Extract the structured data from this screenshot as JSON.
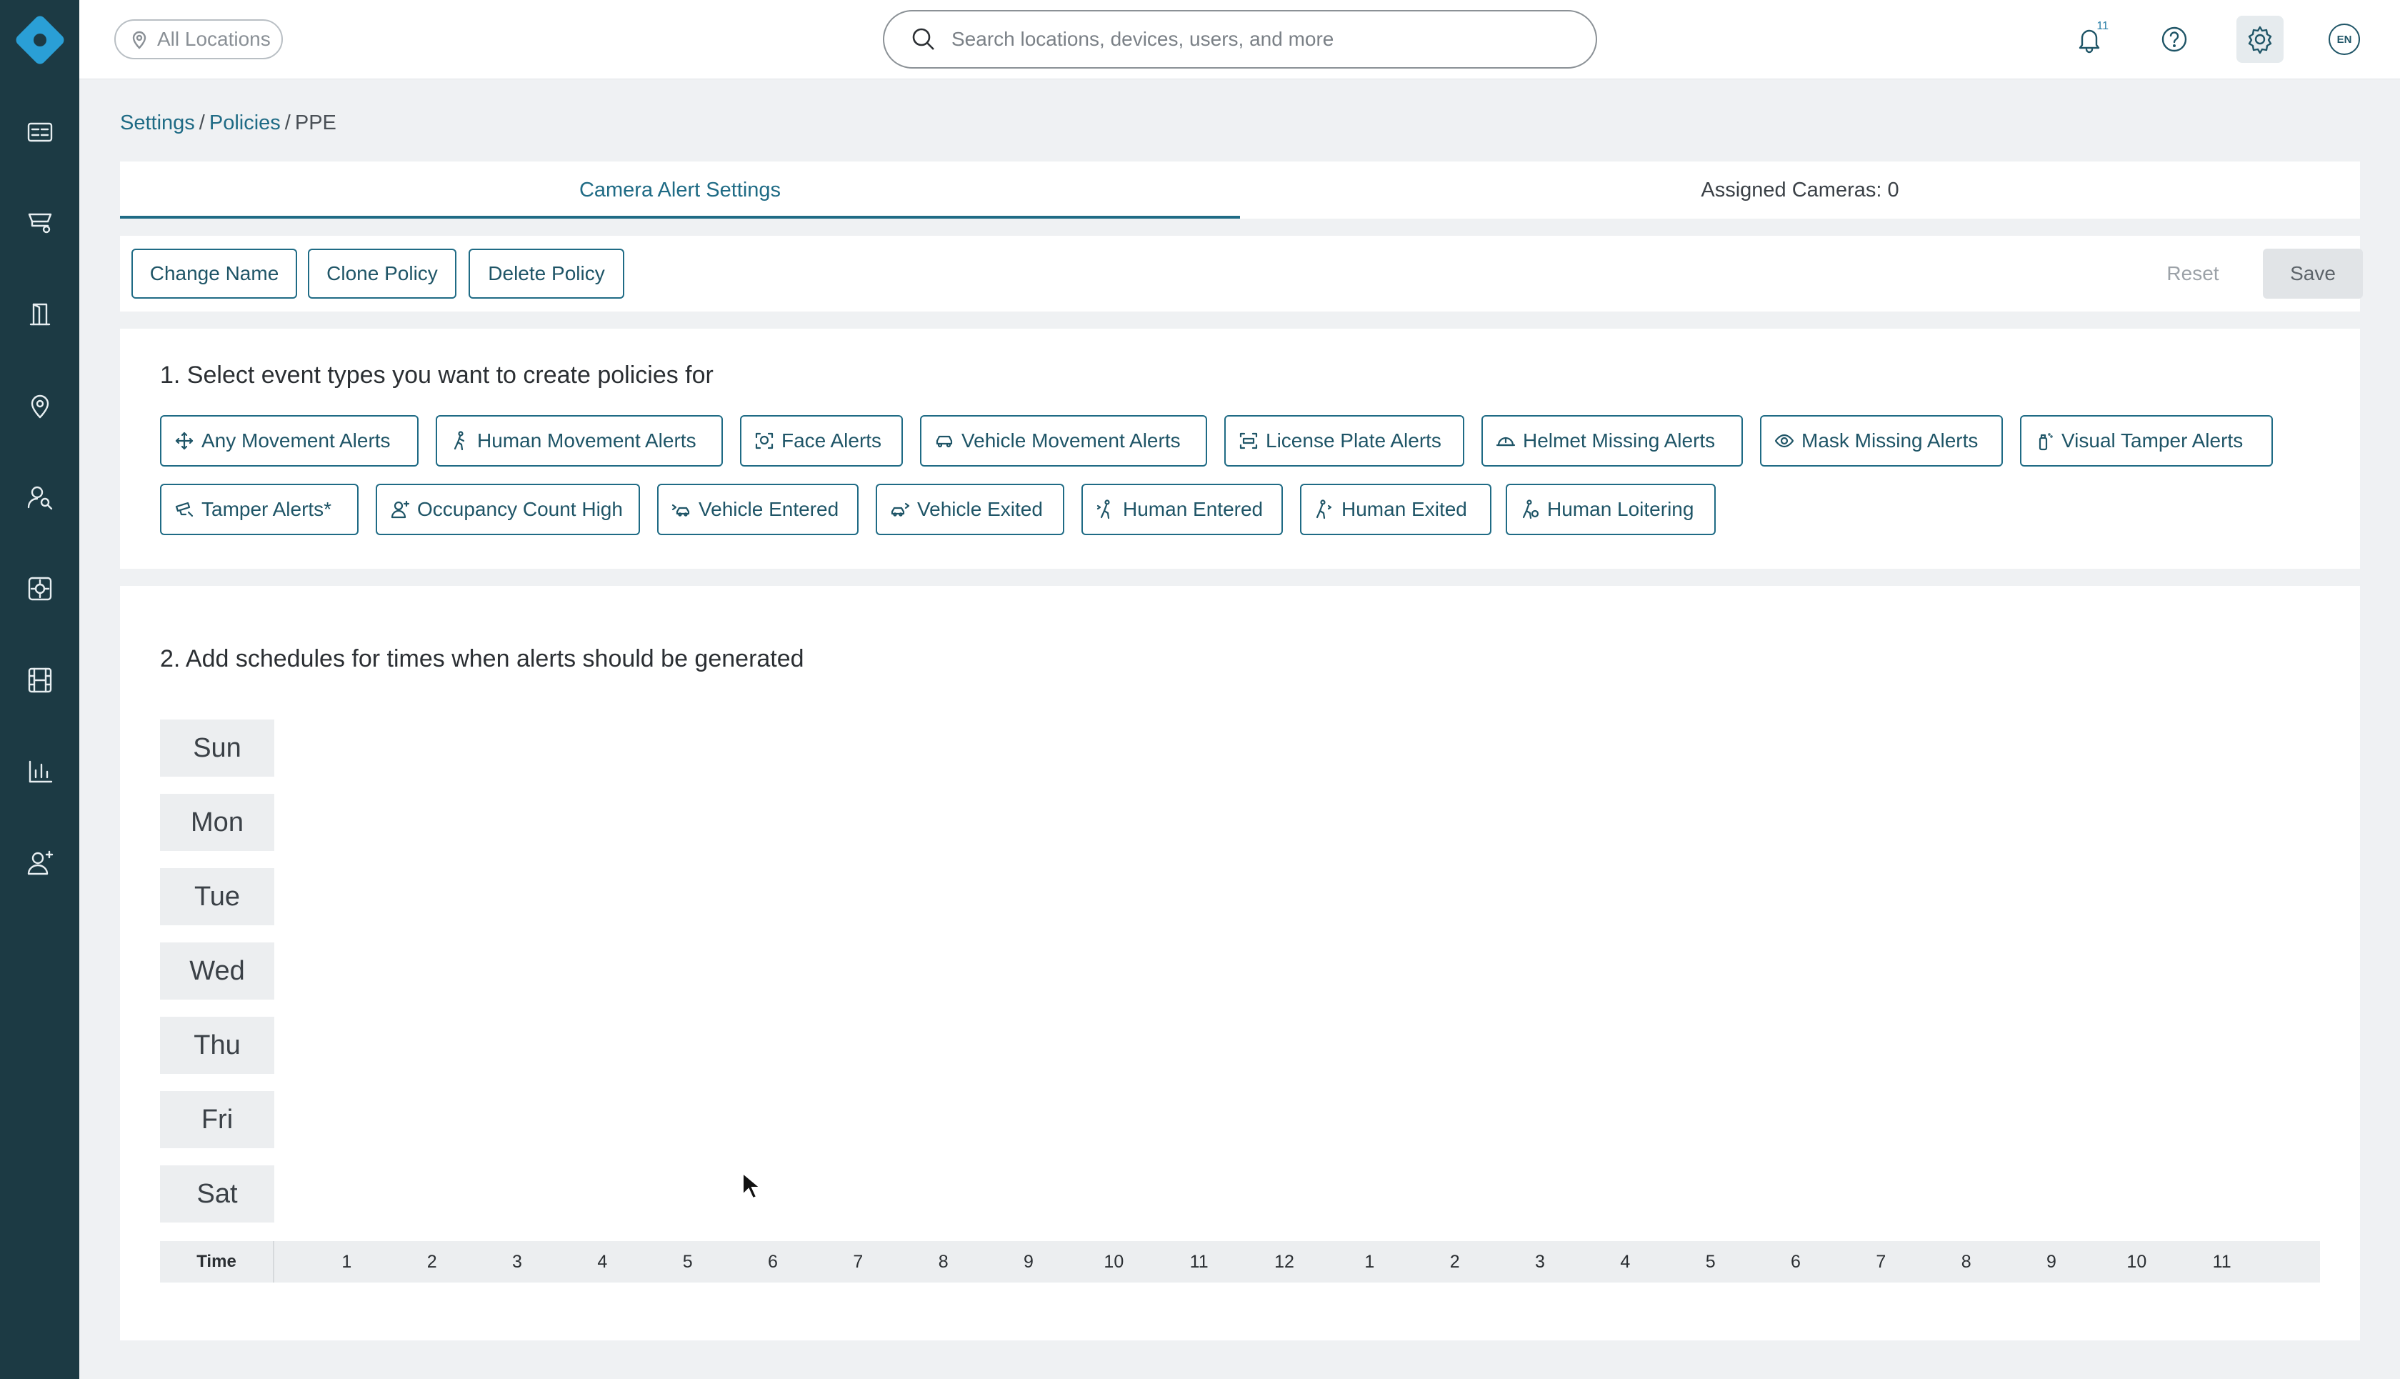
{
  "topbar": {
    "location_filter": "All Locations",
    "search_placeholder": "Search locations, devices, users, and more",
    "notification_count": "11",
    "language": "EN"
  },
  "breadcrumb": {
    "items": [
      "Settings",
      "Policies",
      "PPE"
    ]
  },
  "tabs": [
    {
      "label": "Camera Alert Settings",
      "active": true
    },
    {
      "label": "Assigned Cameras: 0",
      "active": false
    }
  ],
  "actions": {
    "change_name": "Change Name",
    "clone_policy": "Clone Policy",
    "delete_policy": "Delete Policy",
    "reset": "Reset",
    "save": "Save"
  },
  "section1": {
    "title": "1. Select event types you want to create policies for",
    "event_types": [
      {
        "label": "Any Movement Alerts",
        "icon": "move-icon"
      },
      {
        "label": "Human Movement Alerts",
        "icon": "walking-person-icon"
      },
      {
        "label": "Face Alerts",
        "icon": "face-scan-icon"
      },
      {
        "label": "Vehicle Movement Alerts",
        "icon": "car-icon"
      },
      {
        "label": "License Plate Alerts",
        "icon": "license-plate-icon"
      },
      {
        "label": "Helmet Missing Alerts",
        "icon": "helmet-icon"
      },
      {
        "label": "Mask Missing Alerts",
        "icon": "eye-icon"
      },
      {
        "label": "Visual Tamper Alerts",
        "icon": "spray-can-icon"
      },
      {
        "label": "Tamper Alerts*",
        "icon": "camera-tamper-icon"
      },
      {
        "label": "Occupancy Count High",
        "icon": "user-plus-icon"
      },
      {
        "label": "Vehicle Entered",
        "icon": "car-enter-icon"
      },
      {
        "label": "Vehicle Exited",
        "icon": "car-exit-icon"
      },
      {
        "label": "Human Entered",
        "icon": "person-enter-icon"
      },
      {
        "label": "Human Exited",
        "icon": "person-exit-icon"
      },
      {
        "label": "Human Loitering",
        "icon": "person-loiter-icon"
      }
    ]
  },
  "section2": {
    "title": "2. Add schedules for times when alerts should be generated",
    "days": [
      "Sun",
      "Mon",
      "Tue",
      "Wed",
      "Thu",
      "Fri",
      "Sat"
    ],
    "time_label": "Time",
    "hours": [
      "1",
      "2",
      "3",
      "4",
      "5",
      "6",
      "7",
      "8",
      "9",
      "10",
      "11",
      "12",
      "1",
      "2",
      "3",
      "4",
      "5",
      "6",
      "7",
      "8",
      "9",
      "10",
      "11"
    ]
  },
  "colors": {
    "rail": "#1c3a44",
    "accent": "#1f6b85",
    "logo": "#2a9fd6"
  }
}
